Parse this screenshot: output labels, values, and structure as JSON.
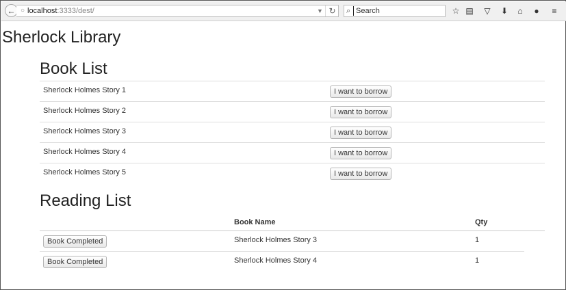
{
  "browser": {
    "url_host": "localhost",
    "url_rest": ":3333/dest/",
    "search_placeholder": "Search"
  },
  "page": {
    "site_title": "Sherlock Library"
  },
  "book_list": {
    "title": "Book List",
    "borrow_label": "I want to borrow",
    "books": [
      {
        "name": "Sherlock Holmes Story 1",
        "action": "I want to borrow"
      },
      {
        "name": "Sherlock Holmes Story 2",
        "action": "I want to borrow"
      },
      {
        "name": "Sherlock Holmes Story 3",
        "action": "I want to borrow"
      },
      {
        "name": "Sherlock Holmes Story 4",
        "action": "I want to borrow"
      },
      {
        "name": "Sherlock Holmes Story 5",
        "action": "I want to borrow"
      }
    ]
  },
  "reading_list": {
    "title": "Reading List",
    "columns": [
      "",
      "Book Name",
      "Qty"
    ],
    "rows": [
      {
        "action": "Book Completed",
        "name": "Sherlock Holmes Story 3",
        "qty": "1"
      },
      {
        "action": "Book Completed",
        "name": "Sherlock Holmes Story 4",
        "qty": "1"
      }
    ]
  }
}
